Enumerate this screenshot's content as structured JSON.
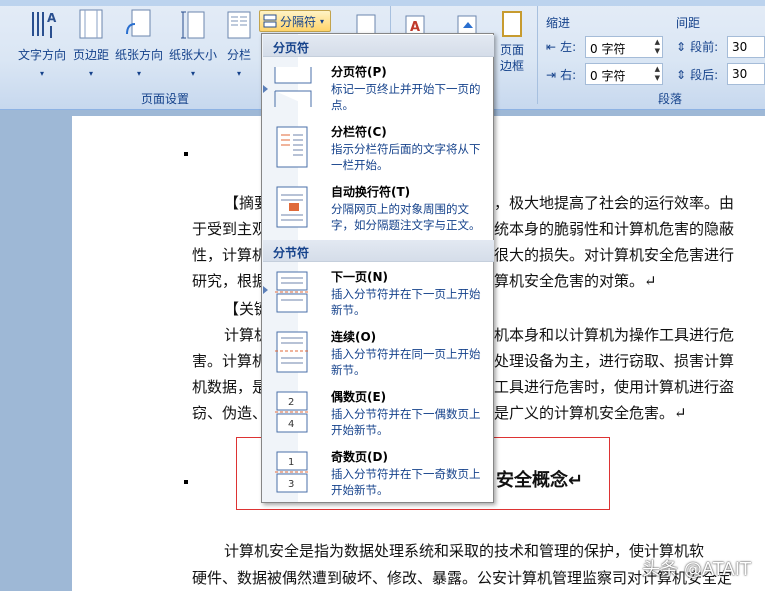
{
  "ribbon": {
    "buttons": [
      {
        "label": "文字方向"
      },
      {
        "label": "页边距"
      },
      {
        "label": "纸张方向"
      },
      {
        "label": "纸张大小"
      },
      {
        "label": "分栏"
      }
    ],
    "breaks_button": "分隔符",
    "page_setup_label": "页面设置",
    "page_border_label": "页面\n边框",
    "indent_label": "缩进",
    "spacing_label": "间距",
    "left_label": "左:",
    "right_label": "右:",
    "left_value": "0 字符",
    "right_value": "0 字符",
    "before_label": "段前:",
    "after_label": "段后:",
    "before_value": "30",
    "after_value": "30",
    "paragraph_label": "段落"
  },
  "menu": {
    "section_page_breaks": "分页符",
    "section_section_breaks": "分节符",
    "items": [
      {
        "title": "分页符(P)",
        "desc": "标记一页终止并开始下一页的点。"
      },
      {
        "title": "分栏符(C)",
        "desc": "指示分栏符后面的文字将从下一栏开始。"
      },
      {
        "title": "自动换行符(T)",
        "desc": "分隔网页上的对象周围的文字，如分隔题注文字与正文。"
      },
      {
        "title": "下一页(N)",
        "desc": "插入分节符并在下一页上开始新节。"
      },
      {
        "title": "连续(O)",
        "desc": "插入分节符并在同一页上开始新节。"
      },
      {
        "title": "偶数页(E)",
        "desc": "插入分节符并在下一偶数页上开始新节。"
      },
      {
        "title": "奇数页(D)",
        "desc": "插入分节符并在下一奇数页上开始新节。"
      }
    ]
  },
  "document": {
    "lines": [
      "【摘要",
      "，极大地提高了社会的运行效率。由",
      "于受到主观",
      "统本身的脆弱性和计算机危害的隐蔽",
      "性，计算机",
      "很大的损失。对计算机安全危害进行",
      "研究，根据",
      "算机安全危害的对策。↵",
      "【关键",
      "计算机",
      "机本身和以计算机为操作工具进行危",
      "害。计算机",
      "处理设备为主，进行窃取、损害计算",
      "机数据，是",
      "工具进行危害时，使用计算机进行盗",
      "窃、伪造、",
      "是广义的计算机安全危害。↵",
      "安全概念↵",
      "计算机安全是指为数据处理系统和采取的技术和管理的保护，使计算机软",
      "硬件、数据被偶然遭到破坏、修改、暴露。公安计算机管理监察司对计算机安全定"
    ],
    "watermark": "头条 @ATAIT"
  }
}
